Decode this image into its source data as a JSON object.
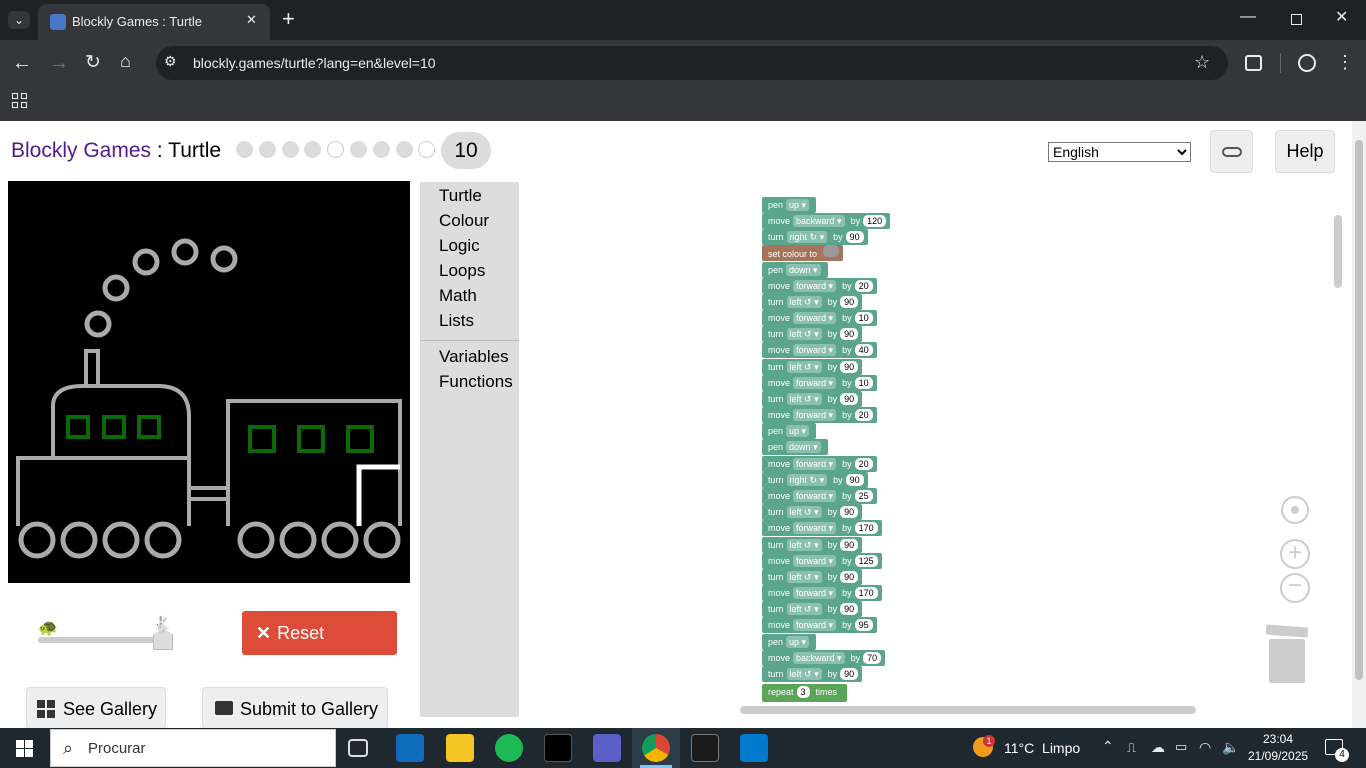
{
  "browser": {
    "tab_title": "Blockly Games : Turtle",
    "url": "blockly.games/turtle?lang=en&level=10",
    "close_tab": "✕",
    "new_tab": "+"
  },
  "app": {
    "brand": "Blockly Games",
    "separator": " : ",
    "game": "Turtle",
    "level_number": "10",
    "levels_total": 10,
    "current_level": 10,
    "language": "English",
    "help_label": "Help"
  },
  "toolbox": {
    "categories": [
      "Turtle",
      "Colour",
      "Logic",
      "Loops",
      "Math",
      "Lists"
    ],
    "categories2": [
      "Variables",
      "Functions"
    ]
  },
  "controls": {
    "reset_label": "Reset",
    "see_gallery_label": "See Gallery",
    "submit_label": "Submit to Gallery",
    "speed_fraction": 1.0
  },
  "blocks": [
    {
      "kind": "pen",
      "word": "pen",
      "opt": "up"
    },
    {
      "kind": "move",
      "word": "move",
      "opt": "backward",
      "by": "by",
      "val": "120"
    },
    {
      "kind": "turn",
      "word": "turn",
      "opt": "right ↻",
      "by": "by",
      "val": "90"
    },
    {
      "kind": "colour",
      "word": "set colour to"
    },
    {
      "kind": "pen",
      "word": "pen",
      "opt": "down"
    },
    {
      "kind": "move",
      "word": "move",
      "opt": "forward",
      "by": "by",
      "val": "20"
    },
    {
      "kind": "turn",
      "word": "turn",
      "opt": "left ↺",
      "by": "by",
      "val": "90"
    },
    {
      "kind": "move",
      "word": "move",
      "opt": "forward",
      "by": "by",
      "val": "10"
    },
    {
      "kind": "turn",
      "word": "turn",
      "opt": "left ↺",
      "by": "by",
      "val": "90"
    },
    {
      "kind": "move",
      "word": "move",
      "opt": "forward",
      "by": "by",
      "val": "40"
    },
    {
      "kind": "turn",
      "word": "turn",
      "opt": "left ↺",
      "by": "by",
      "val": "90"
    },
    {
      "kind": "move",
      "word": "move",
      "opt": "forward",
      "by": "by",
      "val": "10"
    },
    {
      "kind": "turn",
      "word": "turn",
      "opt": "left ↺",
      "by": "by",
      "val": "90"
    },
    {
      "kind": "move",
      "word": "move",
      "opt": "forward",
      "by": "by",
      "val": "20"
    },
    {
      "kind": "pen",
      "word": "pen",
      "opt": "up"
    },
    {
      "kind": "pen",
      "word": "pen",
      "opt": "down"
    },
    {
      "kind": "move",
      "word": "move",
      "opt": "forward",
      "by": "by",
      "val": "20"
    },
    {
      "kind": "turn",
      "word": "turn",
      "opt": "right ↻",
      "by": "by",
      "val": "90"
    },
    {
      "kind": "move",
      "word": "move",
      "opt": "forward",
      "by": "by",
      "val": "25"
    },
    {
      "kind": "turn",
      "word": "turn",
      "opt": "left ↺",
      "by": "by",
      "val": "90"
    },
    {
      "kind": "move",
      "word": "move",
      "opt": "forward",
      "by": "by",
      "val": "170"
    },
    {
      "kind": "turn",
      "word": "turn",
      "opt": "left ↺",
      "by": "by",
      "val": "90"
    },
    {
      "kind": "move",
      "word": "move",
      "opt": "forward",
      "by": "by",
      "val": "125"
    },
    {
      "kind": "turn",
      "word": "turn",
      "opt": "left ↺",
      "by": "by",
      "val": "90"
    },
    {
      "kind": "move",
      "word": "move",
      "opt": "forward",
      "by": "by",
      "val": "170"
    },
    {
      "kind": "turn",
      "word": "turn",
      "opt": "left ↺",
      "by": "by",
      "val": "90"
    },
    {
      "kind": "move",
      "word": "move",
      "opt": "forward",
      "by": "by",
      "val": "95"
    },
    {
      "kind": "pen",
      "word": "pen",
      "opt": "up"
    },
    {
      "kind": "move",
      "word": "move",
      "opt": "backward",
      "by": "by",
      "val": "70"
    },
    {
      "kind": "turn",
      "word": "turn",
      "opt": "left ↺",
      "by": "by",
      "val": "90"
    },
    {
      "kind": "repeat",
      "word": "repeat",
      "val": "3",
      "tail": "times"
    }
  ],
  "colors": {
    "turtle_block": "#5ba58c",
    "colour_block": "#a5745b",
    "loop_block": "#5ba55b",
    "brand_purple": "#551a8b",
    "reset_red": "#dd4b39"
  },
  "taskbar": {
    "search_placeholder": "Procurar",
    "weather_temp": "11°C",
    "weather_text": "Limpo",
    "time": "23:04",
    "date": "21/09/2025",
    "notifications": "4",
    "weather_badge": "1"
  }
}
